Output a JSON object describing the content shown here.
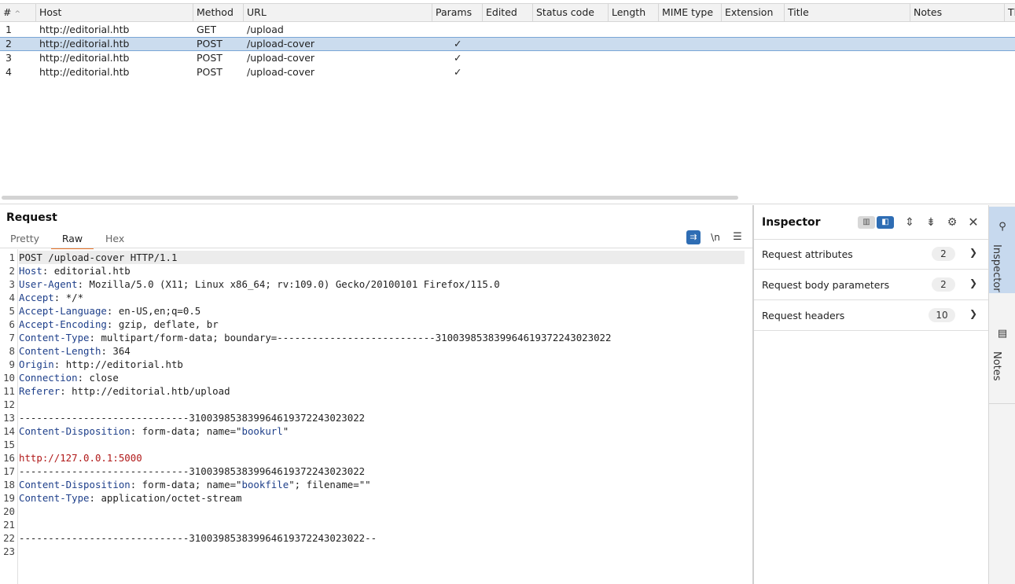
{
  "history": {
    "columns": [
      {
        "label": "#",
        "sort": "^"
      },
      {
        "label": "Host"
      },
      {
        "label": "Method"
      },
      {
        "label": "URL"
      },
      {
        "label": "Params"
      },
      {
        "label": "Edited"
      },
      {
        "label": "Status code"
      },
      {
        "label": "Length"
      },
      {
        "label": "MIME type"
      },
      {
        "label": "Extension"
      },
      {
        "label": "Title"
      },
      {
        "label": "Notes"
      },
      {
        "label": "Tl"
      }
    ],
    "rows": [
      {
        "num": "1",
        "host": "http://editorial.htb",
        "method": "GET",
        "url": "/upload",
        "params": ""
      },
      {
        "num": "2",
        "host": "http://editorial.htb",
        "method": "POST",
        "url": "/upload-cover",
        "params": "✓"
      },
      {
        "num": "3",
        "host": "http://editorial.htb",
        "method": "POST",
        "url": "/upload-cover",
        "params": "✓"
      },
      {
        "num": "4",
        "host": "http://editorial.htb",
        "method": "POST",
        "url": "/upload-cover",
        "params": "✓"
      }
    ]
  },
  "request": {
    "title": "Request",
    "tabs": [
      "Pretty",
      "Raw",
      "Hex"
    ],
    "active_tab": "Raw",
    "newline_toggle": "\\n",
    "lines": [
      {
        "n": "1",
        "k": "",
        "v": "POST /upload-cover HTTP/1.1"
      },
      {
        "n": "2",
        "k": "Host",
        "v": " editorial.htb"
      },
      {
        "n": "3",
        "k": "User-Agent",
        "v": " Mozilla/5.0 (X11; Linux x86_64; rv:109.0) Gecko/20100101 Firefox/115.0"
      },
      {
        "n": "4",
        "k": "Accept",
        "v": " */*"
      },
      {
        "n": "5",
        "k": "Accept-Language",
        "v": " en-US,en;q=0.5"
      },
      {
        "n": "6",
        "k": "Accept-Encoding",
        "v": " gzip, deflate, br"
      },
      {
        "n": "7",
        "k": "Content-Type",
        "v": " multipart/form-data; boundary=---------------------------310039853839964619372243023022"
      },
      {
        "n": "8",
        "k": "Content-Length",
        "v": " 364"
      },
      {
        "n": "9",
        "k": "Origin",
        "v": " http://editorial.htb"
      },
      {
        "n": "10",
        "k": "Connection",
        "v": " close"
      },
      {
        "n": "11",
        "k": "Referer",
        "v": " http://editorial.htb/upload"
      },
      {
        "n": "12",
        "k": "",
        "v": ""
      },
      {
        "n": "13",
        "k": "",
        "v": "-----------------------------310039853839964619372243023022"
      },
      {
        "n": "14",
        "k": "Content-Disposition",
        "v": " form-data; name=\"",
        "attr": "bookurl",
        "tail": "\""
      },
      {
        "n": "15",
        "k": "",
        "v": ""
      },
      {
        "n": "16",
        "k": "",
        "v": "",
        "url": "http://127.0.0.1:5000"
      },
      {
        "n": "17",
        "k": "",
        "v": "-----------------------------310039853839964619372243023022"
      },
      {
        "n": "18",
        "k": "Content-Disposition",
        "v": " form-data; name=\"",
        "attr": "bookfile",
        "tail": "\"; filename=\"\""
      },
      {
        "n": "19",
        "k": "Content-Type",
        "v": " application/octet-stream"
      },
      {
        "n": "20",
        "k": "",
        "v": ""
      },
      {
        "n": "21",
        "k": "",
        "v": ""
      },
      {
        "n": "22",
        "k": "",
        "v": "-----------------------------310039853839964619372243023022--"
      },
      {
        "n": "23",
        "k": "",
        "v": ""
      }
    ]
  },
  "inspector": {
    "title": "Inspector",
    "sections": [
      {
        "label": "Request attributes",
        "count": "2"
      },
      {
        "label": "Request body parameters",
        "count": "2"
      },
      {
        "label": "Request headers",
        "count": "10"
      }
    ]
  },
  "rail": {
    "inspector_label": "Inspector",
    "notes_label": "Notes"
  }
}
